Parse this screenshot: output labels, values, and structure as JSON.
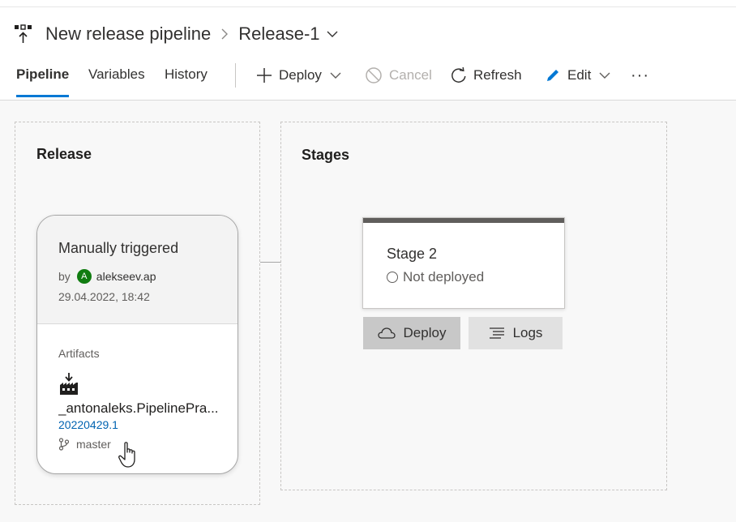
{
  "header": {
    "pipeline_name": "New release pipeline",
    "separator": ">",
    "release_name": "Release-1"
  },
  "tabs": [
    {
      "label": "Pipeline",
      "active": true
    },
    {
      "label": "Variables",
      "active": false
    },
    {
      "label": "History",
      "active": false
    }
  ],
  "toolbar": {
    "deploy_label": "Deploy",
    "cancel_label": "Cancel",
    "refresh_label": "Refresh",
    "edit_label": "Edit",
    "more_label": "···"
  },
  "release_panel": {
    "title": "Release",
    "trigger": "Manually triggered",
    "by_label": "by",
    "avatar_initial": "A",
    "user": "alekseev.ap",
    "date": "29.04.2022, 18:42",
    "artifacts_label": "Artifacts",
    "artifact_name": "_antonaleks.PipelinePra...",
    "artifact_version": "20220429.1",
    "branch": "master"
  },
  "stages_panel": {
    "title": "Stages",
    "stage_name": "Stage 2",
    "stage_status": "Not deployed",
    "deploy_button": "Deploy",
    "logs_button": "Logs"
  },
  "colors": {
    "accent": "#0078d4",
    "avatar": "#107c10",
    "link": "#0063b1"
  }
}
